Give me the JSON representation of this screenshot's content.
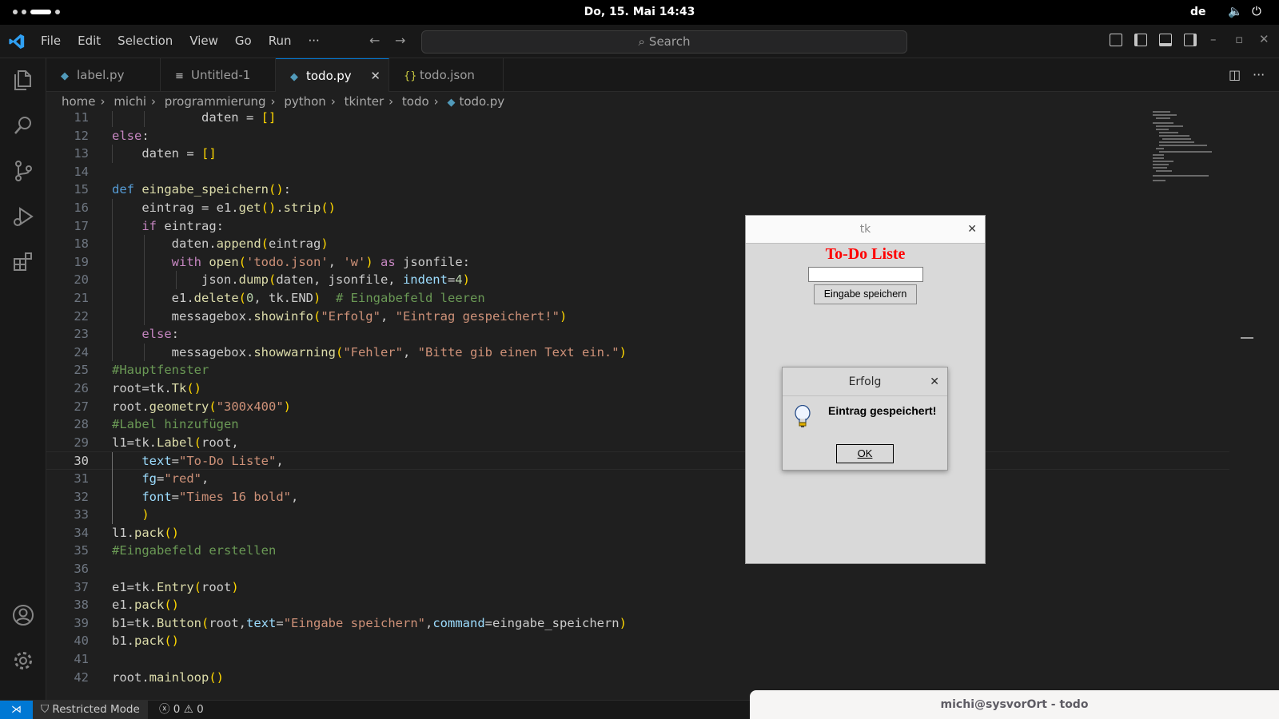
{
  "topbar": {
    "clock": "Do, 15. Mai  14:43",
    "language": "de"
  },
  "titlebar": {
    "menu": [
      "File",
      "Edit",
      "Selection",
      "View",
      "Go",
      "Run",
      "···"
    ],
    "search_placeholder": "Search"
  },
  "tabs": [
    {
      "label": "label.py",
      "icon": "python-icon"
    },
    {
      "label": "Untitled-1",
      "icon": "text-file-icon"
    },
    {
      "label": "todo.py",
      "icon": "python-icon",
      "active": true
    },
    {
      "label": "todo.json",
      "icon": "json-icon"
    }
  ],
  "breadcrumb": [
    "home",
    "michi",
    "programmierung",
    "python",
    "tkinter",
    "todo",
    "todo.py"
  ],
  "editor": {
    "current_line": 30,
    "lines": [
      {
        "n": "11"
      },
      {
        "n": "12"
      },
      {
        "n": "13"
      },
      {
        "n": "14"
      },
      {
        "n": "15"
      },
      {
        "n": "16"
      },
      {
        "n": "17"
      },
      {
        "n": "18"
      },
      {
        "n": "19"
      },
      {
        "n": "20"
      },
      {
        "n": "21"
      },
      {
        "n": "22"
      },
      {
        "n": "23"
      },
      {
        "n": "24"
      },
      {
        "n": "25"
      },
      {
        "n": "26"
      },
      {
        "n": "27"
      },
      {
        "n": "28"
      },
      {
        "n": "29"
      },
      {
        "n": "30"
      },
      {
        "n": "31"
      },
      {
        "n": "32"
      },
      {
        "n": "33"
      },
      {
        "n": "34"
      },
      {
        "n": "35"
      },
      {
        "n": "36"
      },
      {
        "n": "37"
      },
      {
        "n": "38"
      },
      {
        "n": "39"
      },
      {
        "n": "40"
      },
      {
        "n": "41"
      },
      {
        "n": "42"
      }
    ]
  },
  "tk_window": {
    "title": "tk",
    "label": "To-Do Liste",
    "entry_value": "",
    "button": "Eingabe speichern"
  },
  "messagebox": {
    "title": "Erfolg",
    "message": "Eintrag gespeichert!",
    "ok": "OK"
  },
  "statusbar": {
    "remote_icon": "remote-icon",
    "restricted": "Restricted Mode",
    "errors": "0",
    "warnings": "0"
  },
  "terminal": {
    "title": "michi@sysvorOrt - todo"
  },
  "colors": {
    "accent": "#0078d4",
    "tk_label": "#ff0000"
  }
}
